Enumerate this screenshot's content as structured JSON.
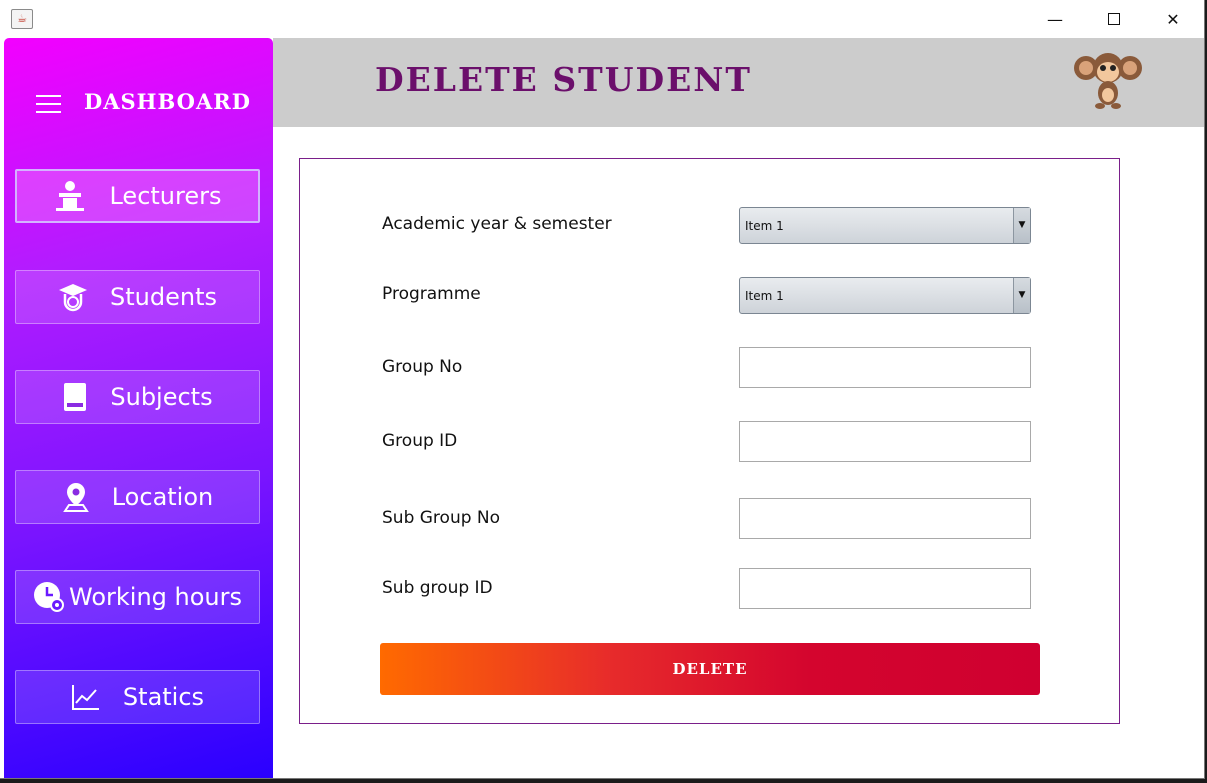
{
  "window": {
    "icon": "java-icon",
    "minimize_glyph": "—",
    "close_glyph": "✕"
  },
  "sidebar": {
    "title": "DASHBOARD",
    "items": [
      {
        "label": "Lecturers",
        "icon": "lecturer-podium-icon",
        "active": true
      },
      {
        "label": "Students",
        "icon": "graduate-cap-icon",
        "active": false
      },
      {
        "label": "Subjects",
        "icon": "book-icon",
        "active": false
      },
      {
        "label": "Location",
        "icon": "map-pin-icon",
        "active": false
      },
      {
        "label": "Working hours",
        "icon": "clock-gear-icon",
        "active": false
      },
      {
        "label": "Statics",
        "icon": "line-chart-icon",
        "active": false
      }
    ]
  },
  "header": {
    "title": "DELETE STUDENT",
    "mascot": "monkey-mascot-icon"
  },
  "form": {
    "academic_year": {
      "label": "Academic year & semester",
      "value": "Item 1"
    },
    "programme": {
      "label": "Programme",
      "value": "Item 1"
    },
    "group_no": {
      "label": "Group No",
      "value": ""
    },
    "group_id": {
      "label": "Group ID",
      "value": ""
    },
    "sub_group_no": {
      "label": "Sub Group No",
      "value": ""
    },
    "sub_group_id": {
      "label": "Sub group ID",
      "value": ""
    },
    "delete_label": "DELETE"
  },
  "colors": {
    "sidebar_top": "#f300ff",
    "sidebar_bottom": "#2a00ff",
    "title_color": "#6b0f6b",
    "delete_start": "#ff6a00",
    "delete_end": "#cf0030"
  }
}
